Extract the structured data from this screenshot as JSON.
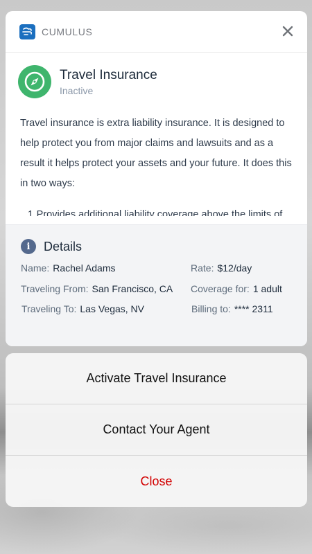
{
  "app": {
    "name": "CUMULUS"
  },
  "product": {
    "title": "Travel Insurance",
    "status": "Inactive",
    "description": "Travel insurance is extra liability insurance. It is designed to help protect you from major claims and lawsuits and as a result it helps protect your assets and your future. It does this in two ways:",
    "list": [
      {
        "num": "1.",
        "text": "Provides additional liability coverage above the limits of your homeowners, auto, and boat insurance policies."
      }
    ]
  },
  "details": {
    "title": "Details",
    "fields": [
      {
        "label": "Name:",
        "value": "Rachel Adams"
      },
      {
        "label": "Traveling From:",
        "value": "San Francisco, CA"
      },
      {
        "label": "Traveling To:",
        "value": "Las Vegas, NV"
      },
      {
        "label": "Rate:",
        "value": "$12/day"
      },
      {
        "label": "Coverage for:",
        "value": "1 adult"
      },
      {
        "label": "Billing to:",
        "value": "**** 2311"
      }
    ]
  },
  "actions": {
    "activate": "Activate Travel Insurance",
    "contact": "Contact Your Agent",
    "close": "Close"
  },
  "colors": {
    "brand": "#1b6fbf",
    "icon_green": "#3fb56d",
    "info_icon": "#54698d",
    "destructive": "#d20000"
  },
  "icons": {
    "app": "cloud-wind-icon",
    "close": "close-icon",
    "product": "compass-icon",
    "details": "info-icon"
  }
}
